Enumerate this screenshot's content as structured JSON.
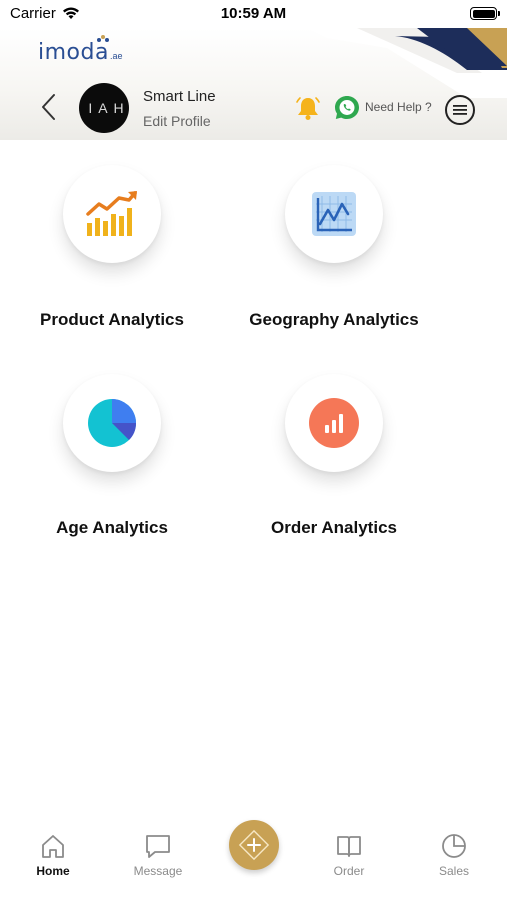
{
  "status_bar": {
    "carrier": "Carrier",
    "time": "10:59 AM"
  },
  "header": {
    "logo_text": "imoda",
    "logo_suffix": ".ae",
    "avatar_text": "IAH",
    "profile_name": "Smart Line",
    "edit_profile": "Edit Profile",
    "help_text": "Need Help ?",
    "icons": [
      "back-chevron-icon",
      "bell-icon",
      "whatsapp-icon",
      "menu-icon"
    ]
  },
  "analytics": [
    {
      "label": "Product Analytics",
      "icon": "bar-chart-trend-icon"
    },
    {
      "label": "Geography Analytics",
      "icon": "line-chart-icon"
    },
    {
      "label": "Age Analytics",
      "icon": "pie-chart-icon"
    },
    {
      "label": "Order Analytics",
      "icon": "order-bars-icon"
    }
  ],
  "tabbar": {
    "tabs": [
      {
        "label": "Home",
        "icon": "home-icon",
        "active": true
      },
      {
        "label": "Message",
        "icon": "message-icon",
        "active": false
      },
      {
        "label": "Order",
        "icon": "book-icon",
        "active": false
      },
      {
        "label": "Sales",
        "icon": "pie-icon",
        "active": false
      }
    ],
    "fab_icon": "plus-diamond-icon"
  },
  "colors": {
    "logo": "#2a4e93",
    "accent_gold": "#c8a154",
    "bell": "#f5b31b",
    "whatsapp": "#2fa84f",
    "product_icon": "#f0a11b",
    "geo_icon": "#3a86d6",
    "pie_cyan": "#13c2d2",
    "pie_blue": "#3f6ee0",
    "order_icon": "#f57757"
  }
}
